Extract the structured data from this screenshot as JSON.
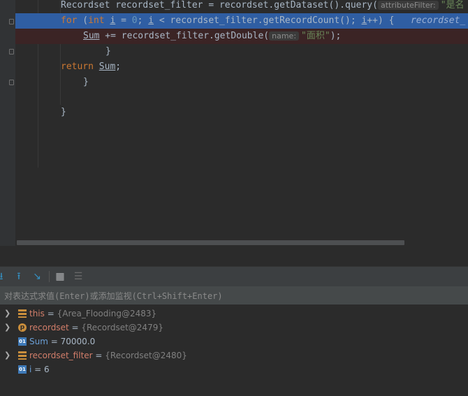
{
  "editor": {
    "lines": {
      "l1": {
        "text_a": "Recordset recordset_filter = recordset.getDataset().query(",
        "hint_name": "attributeFilter:",
        "text_b": "\"是名"
      },
      "l2": {
        "kw": "for",
        "text_a": " (",
        "kw2": "int",
        "var_i": "i",
        "text_b": " = ",
        "num": "0",
        "text_c": "; ",
        "var_i2": "i",
        "text_d": " < recordset_filter.getRecordCount(); ",
        "var_i3": "i",
        "text_e": "++) {",
        "inline_hint": "recordset_"
      },
      "l3": {
        "var_sum": "Sum",
        "text_a": " += recordset_filter.getDouble(",
        "hint_name": "name:",
        "str": "\"面积\"",
        "text_b": ");"
      },
      "l4": {
        "text": "}"
      },
      "l5": {
        "kw": "return",
        "text_a": " ",
        "var_sum": "Sum",
        "text_b": ";"
      },
      "l6": {
        "text": "}"
      },
      "l7": {
        "text": "}"
      }
    }
  },
  "toolbar": {
    "step_into": "⭳",
    "step_out": "⭱",
    "run_to_cursor": "↘",
    "evaluate": "▦",
    "trace": "☰"
  },
  "evaluate": {
    "placeholder": "对表达式求值(Enter)或添加监视(Ctrl+Shift+Enter)"
  },
  "variables": [
    {
      "name": "this",
      "eq": " = ",
      "value": "{Area_Flooding@2483}",
      "icon": "field-icon",
      "expandable": true
    },
    {
      "name": "recordset",
      "eq": " = ",
      "value": "{Recordset@2479}",
      "icon": "parameter-icon",
      "expandable": true
    },
    {
      "name": "Sum",
      "eq": " = ",
      "value": "70000.0",
      "icon": "primitive-icon",
      "expandable": false
    },
    {
      "name": "recordset_filter",
      "eq": " = ",
      "value": "{Recordset@2480}",
      "icon": "field-icon",
      "expandable": true
    },
    {
      "name": "i",
      "eq": " = ",
      "value": "6",
      "icon": "primitive-icon",
      "expandable": false
    }
  ],
  "colors": {
    "exec_line": "#2f5ea3",
    "breakpoint_line": "#3b2425",
    "keyword": "#cc7832",
    "number": "#6897bb",
    "string": "#6a8759",
    "var_name": "#d27e6a"
  }
}
